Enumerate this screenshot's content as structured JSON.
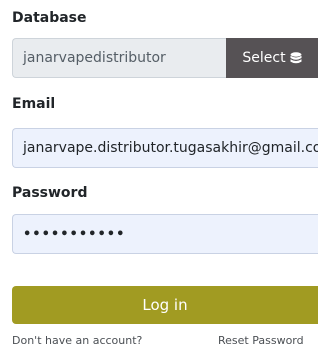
{
  "database": {
    "label": "Database",
    "value": "janarvapedistributor",
    "select_label": "Select",
    "select_icon": "database-icon"
  },
  "email": {
    "label": "Email",
    "value": "janarvape.distributor.tugasakhir@gmail.com"
  },
  "password": {
    "label": "Password",
    "masked_value": "•••••••••••"
  },
  "login": {
    "label": "Log in",
    "color": "#a19b22"
  },
  "links": {
    "signup": "Don't have an account?",
    "reset": "Reset Password"
  },
  "colors": {
    "select_button": "#565255",
    "input_bg": "#edf2fd",
    "readonly_bg": "#e9ecef"
  }
}
